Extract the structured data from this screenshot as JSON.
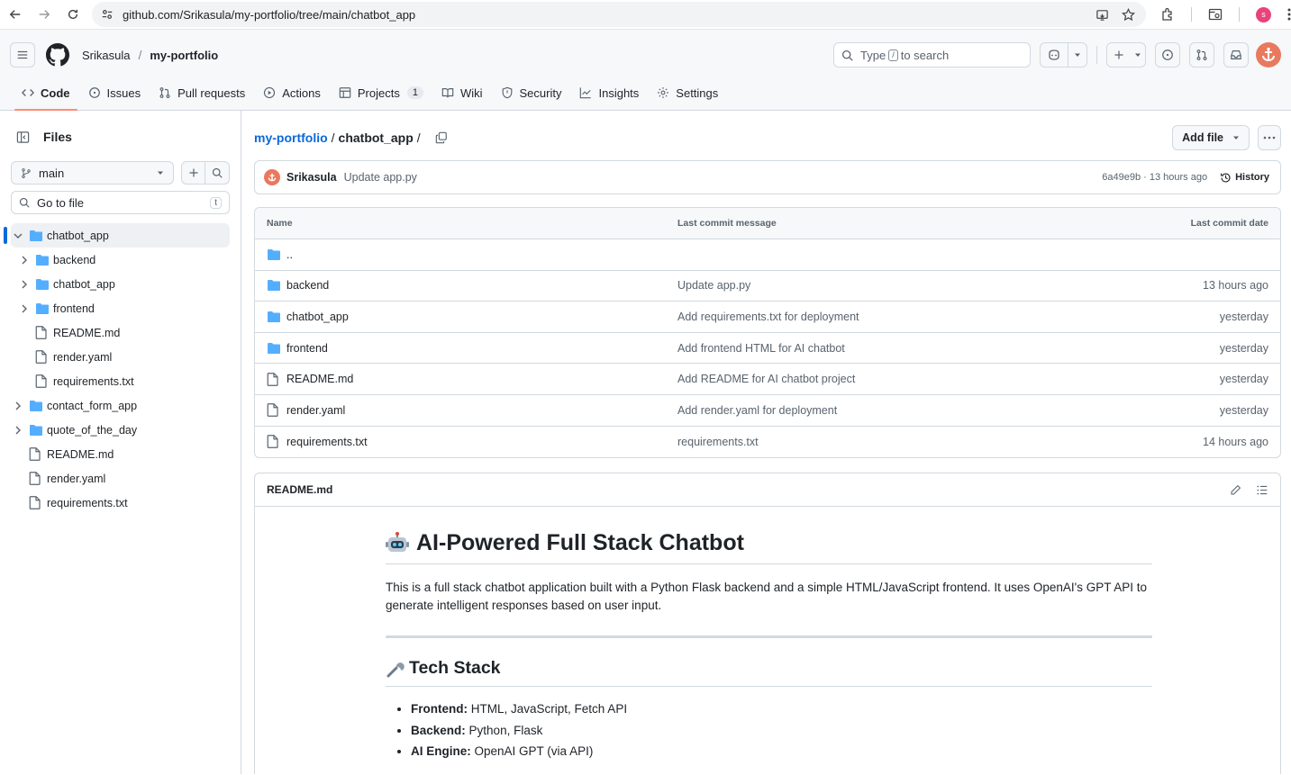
{
  "browser": {
    "url": "github.com/Srikasula/my-portfolio/tree/main/chatbot_app",
    "profile_initial": "s"
  },
  "header": {
    "owner": "Srikasula",
    "repo": "my-portfolio",
    "search_placeholder_pre": "Type",
    "search_key": "/",
    "search_placeholder_post": "to search"
  },
  "tabs": [
    {
      "label": "Code",
      "icon": "code-icon",
      "active": true
    },
    {
      "label": "Issues",
      "icon": "issue-icon"
    },
    {
      "label": "Pull requests",
      "icon": "pull-request-icon"
    },
    {
      "label": "Actions",
      "icon": "play-icon"
    },
    {
      "label": "Projects",
      "icon": "table-icon",
      "counter": "1"
    },
    {
      "label": "Wiki",
      "icon": "book-icon"
    },
    {
      "label": "Security",
      "icon": "shield-icon"
    },
    {
      "label": "Insights",
      "icon": "graph-icon"
    },
    {
      "label": "Settings",
      "icon": "gear-icon"
    }
  ],
  "sidebar": {
    "title": "Files",
    "branch": "main",
    "goto_placeholder": "Go to file",
    "goto_key": "t",
    "tree": [
      {
        "label": "chatbot_app",
        "type": "folder",
        "level": 0,
        "expanded": true,
        "selected": true
      },
      {
        "label": "backend",
        "type": "folder",
        "level": 1
      },
      {
        "label": "chatbot_app",
        "type": "folder",
        "level": 1
      },
      {
        "label": "frontend",
        "type": "folder",
        "level": 1
      },
      {
        "label": "README.md",
        "type": "file",
        "level": 1
      },
      {
        "label": "render.yaml",
        "type": "file",
        "level": 1
      },
      {
        "label": "requirements.txt",
        "type": "file",
        "level": 1
      },
      {
        "label": "contact_form_app",
        "type": "folder",
        "level": 0
      },
      {
        "label": "quote_of_the_day",
        "type": "folder",
        "level": 0
      },
      {
        "label": "README.md",
        "type": "file",
        "level": 0
      },
      {
        "label": "render.yaml",
        "type": "file",
        "level": 0
      },
      {
        "label": "requirements.txt",
        "type": "file",
        "level": 0
      }
    ]
  },
  "breadcrumb": {
    "repo": "my-portfolio",
    "sep": "/",
    "current": "chatbot_app",
    "trail": "/"
  },
  "actions": {
    "add_file": "Add file"
  },
  "commit": {
    "author": "Srikasula",
    "message": "Update app.py",
    "meta": "6a49e9b · 13 hours ago",
    "history": "History"
  },
  "table": {
    "col_name": "Name",
    "col_msg": "Last commit message",
    "col_date": "Last commit date",
    "rows": [
      {
        "name": "..",
        "type": "folder",
        "msg": "",
        "date": ""
      },
      {
        "name": "backend",
        "type": "folder",
        "msg": "Update app.py",
        "date": "13 hours ago"
      },
      {
        "name": "chatbot_app",
        "type": "folder",
        "msg": "Add requirements.txt for deployment",
        "date": "yesterday"
      },
      {
        "name": "frontend",
        "type": "folder",
        "msg": "Add frontend HTML for AI chatbot",
        "date": "yesterday"
      },
      {
        "name": "README.md",
        "type": "file",
        "msg": "Add README for AI chatbot project",
        "date": "yesterday"
      },
      {
        "name": "render.yaml",
        "type": "file",
        "msg": "Add render.yaml for deployment",
        "date": "yesterday"
      },
      {
        "name": "requirements.txt",
        "type": "file",
        "msg": "requirements.txt",
        "date": "14 hours ago"
      }
    ]
  },
  "readme": {
    "filename": "README.md",
    "h1": "AI-Powered Full Stack Chatbot",
    "h1_emoji": "robot-icon",
    "intro": "This is a full stack chatbot application built with a Python Flask backend and a simple HTML/JavaScript frontend. It uses OpenAI's GPT API to generate intelligent responses based on user input.",
    "h2": "Tech Stack",
    "h2_emoji": "wrench-icon",
    "stack": [
      {
        "key": "Frontend:",
        "value": "HTML, JavaScript, Fetch API"
      },
      {
        "key": "Backend:",
        "value": "Python, Flask"
      },
      {
        "key": "AI Engine:",
        "value": "OpenAI GPT (via API)"
      }
    ]
  },
  "colors": {
    "accent_link": "#0969da",
    "tab_underline": "#fd8c73",
    "folder": "#54aeff",
    "avatar": "#e9795e",
    "profile": "#e8437a"
  }
}
